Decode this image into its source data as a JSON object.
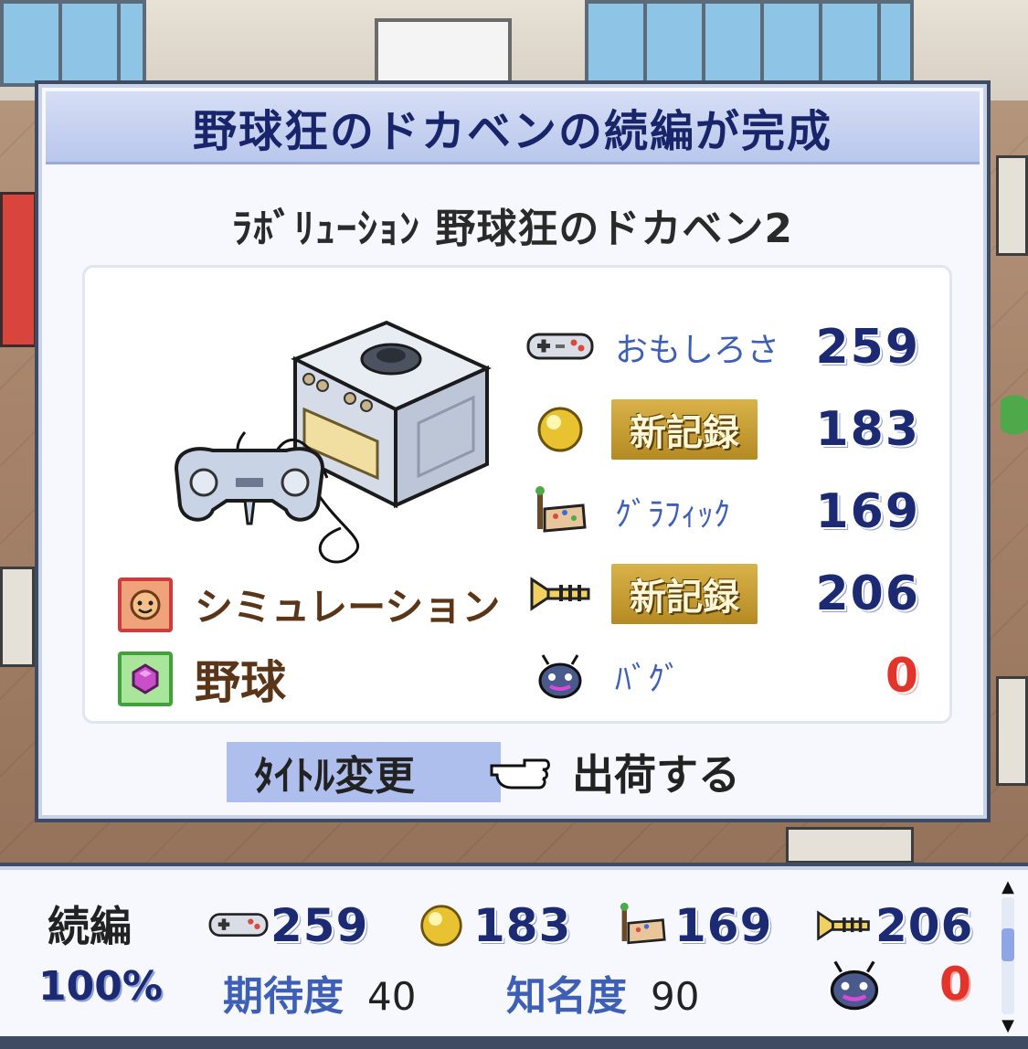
{
  "dialog": {
    "title": "野球狂のドカベンの続編が完成",
    "game_name": "ﾗﾎﾞﾘｭｰｼｮﾝ 野球狂のドカベン2",
    "genres": [
      {
        "icon": "simulation-face-icon",
        "label": "シミュレーション"
      },
      {
        "icon": "baseball-gem-icon",
        "label": "野球"
      }
    ],
    "stats": [
      {
        "icon": "controller-icon",
        "label": "おもしろさ",
        "badge": "",
        "value": "259"
      },
      {
        "icon": "gold-orb-icon",
        "label": "",
        "badge": "新記録",
        "value": "183"
      },
      {
        "icon": "paint-palette-icon",
        "label": "ｸﾞﾗﾌｨｯｸ",
        "badge": "",
        "value": "169"
      },
      {
        "icon": "trumpet-icon",
        "label": "",
        "badge": "新記録",
        "value": "206"
      },
      {
        "icon": "bug-icon",
        "label": "ﾊﾞｸﾞ",
        "badge": "",
        "value": "0"
      }
    ],
    "rename_label": "ﾀｲﾄﾙ変更",
    "ship_label": "出荷する"
  },
  "status": {
    "kind": "続編",
    "percent": "100%",
    "fun": "259",
    "creativity": "183",
    "graphics": "169",
    "sound": "206",
    "expectation_label": "期待度",
    "expectation_value": "40",
    "fame_label": "知名度",
    "fame_value": "90",
    "bugs": "0"
  },
  "colors": {
    "title_text": "#18256b",
    "stat_value": "#1b2a73",
    "label_blue": "#3d5fb5",
    "bug_red": "#e3342b",
    "record_gold": "#c99a2e"
  }
}
